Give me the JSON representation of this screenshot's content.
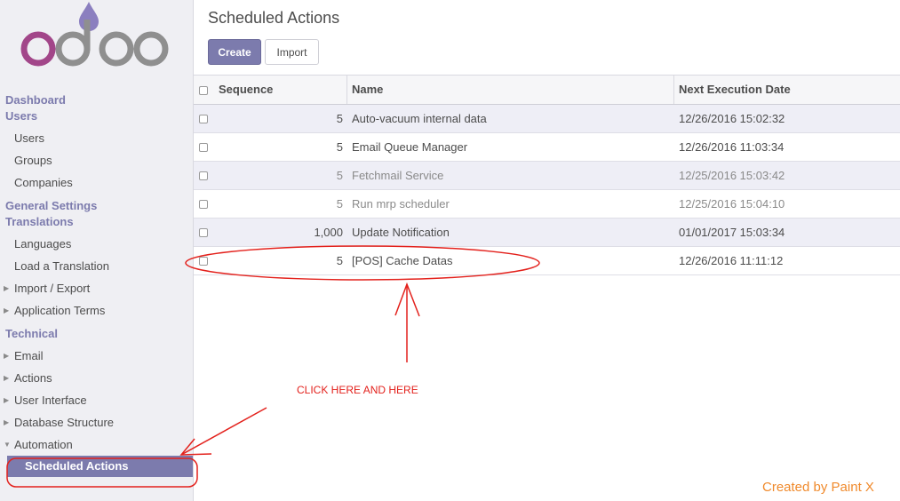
{
  "logo": {
    "text": "odoo",
    "colors": {
      "o": "#a24689",
      "d": "#8f8f8f",
      "drop": "#8b7fbf"
    }
  },
  "sidebar": {
    "sections": [
      {
        "header": "Dashboard"
      },
      {
        "header": "Users",
        "items": [
          {
            "label": "Users"
          },
          {
            "label": "Groups"
          },
          {
            "label": "Companies"
          }
        ]
      },
      {
        "header": "General Settings"
      },
      {
        "header": "Translations",
        "items": [
          {
            "label": "Languages"
          },
          {
            "label": "Load a Translation"
          },
          {
            "label": "Import / Export",
            "caret": "right"
          },
          {
            "label": "Application Terms",
            "caret": "right"
          }
        ]
      },
      {
        "header": "Technical",
        "items": [
          {
            "label": "Email",
            "caret": "right"
          },
          {
            "label": "Actions",
            "caret": "right"
          },
          {
            "label": "User Interface",
            "caret": "right"
          },
          {
            "label": "Database Structure",
            "caret": "right"
          },
          {
            "label": "Automation",
            "caret": "down"
          },
          {
            "label": "Scheduled Actions",
            "active": true
          }
        ]
      }
    ]
  },
  "main": {
    "title": "Scheduled Actions",
    "buttons": {
      "create": "Create",
      "import": "Import"
    },
    "table": {
      "columns": [
        "Sequence",
        "Name",
        "Next Execution Date"
      ],
      "rows": [
        {
          "sequence": "5",
          "name": "Auto-vacuum internal data",
          "date": "12/26/2016 15:02:32",
          "active": true
        },
        {
          "sequence": "5",
          "name": "Email Queue Manager",
          "date": "12/26/2016 11:03:34",
          "active": true
        },
        {
          "sequence": "5",
          "name": "Fetchmail Service",
          "date": "12/25/2016 15:03:42",
          "active": false
        },
        {
          "sequence": "5",
          "name": "Run mrp scheduler",
          "date": "12/25/2016 15:04:10",
          "active": false
        },
        {
          "sequence": "1,000",
          "name": "Update Notification",
          "date": "01/01/2017 15:03:34",
          "active": true
        },
        {
          "sequence": "5",
          "name": "[POS] Cache Datas",
          "date": "12/26/2016 11:11:12",
          "active": true
        }
      ]
    }
  },
  "annotation": {
    "text": "CLICK HERE AND HERE",
    "color": "#e3211c"
  },
  "watermark": "Created by Paint X",
  "colors": {
    "accent": "#7c7bad",
    "annotation": "#e3211c",
    "watermark": "#f08a2c"
  }
}
